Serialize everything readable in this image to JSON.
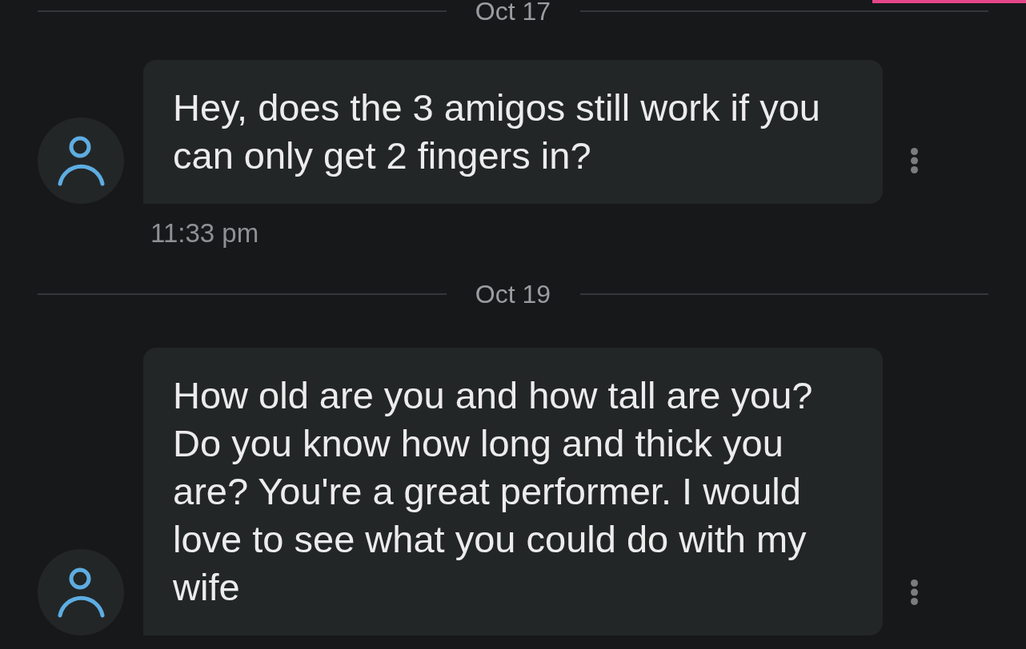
{
  "conversation": [
    {
      "kind": "date",
      "label": "Oct 17"
    },
    {
      "kind": "message",
      "text": "Hey, does the 3 amigos still work if you can only get 2 fingers in?",
      "time": "11:33 pm"
    },
    {
      "kind": "date",
      "label": "Oct 19"
    },
    {
      "kind": "message",
      "text": "How old are you and how tall are you? Do you know how long and thick you are? You're a great performer. I would love to see what you could do with my wife"
    }
  ]
}
